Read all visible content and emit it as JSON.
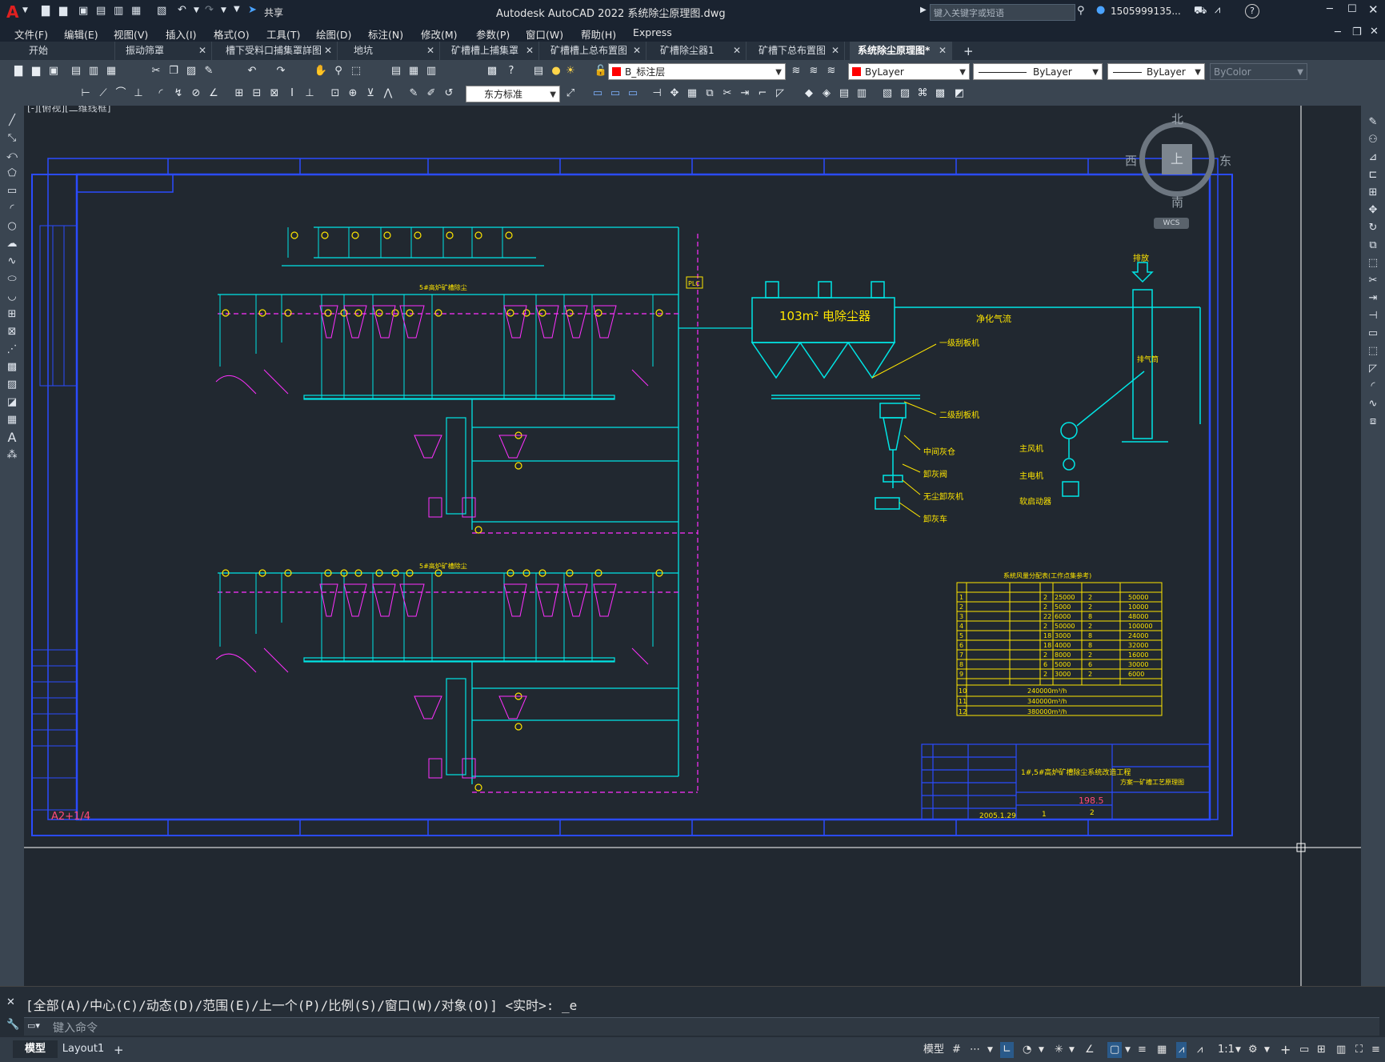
{
  "titlebar": {
    "app_letter": "A",
    "share_label": "共享",
    "title": "Autodesk AutoCAD 2022    系统除尘原理图.dwg",
    "search_placeholder": "键入关键字或短语",
    "user": "1505999135...",
    "help": "?"
  },
  "menu": [
    "文件(F)",
    "编辑(E)",
    "视图(V)",
    "插入(I)",
    "格式(O)",
    "工具(T)",
    "绘图(D)",
    "标注(N)",
    "修改(M)",
    "参数(P)",
    "窗口(W)",
    "帮助(H)",
    "Express"
  ],
  "tabs": [
    {
      "label": "开始",
      "active": false,
      "close": false
    },
    {
      "label": "振动筛罩",
      "active": false,
      "close": true
    },
    {
      "label": "槽下受料口捕集罩詳图",
      "active": false,
      "close": true
    },
    {
      "label": "地坑",
      "active": false,
      "close": true
    },
    {
      "label": "矿槽槽上捕集罩",
      "active": false,
      "close": true
    },
    {
      "label": "矿槽槽上总布置图",
      "active": false,
      "close": true
    },
    {
      "label": "矿槽除尘器1",
      "active": false,
      "close": true
    },
    {
      "label": "矿槽下总布置图",
      "active": false,
      "close": true
    },
    {
      "label": "系统除尘原理图*",
      "active": true,
      "close": true
    }
  ],
  "toolbar": {
    "layer": "B_标注层",
    "color": "ByLayer",
    "linetype": "ByLayer",
    "lineweight": "ByLayer",
    "plotstyle": "ByColor",
    "dimstyle": "东方标准"
  },
  "viewport": {
    "label": "[-][俯视][二维线框]",
    "compass_n": "北",
    "compass_s": "南",
    "compass_e": "东",
    "compass_w": "西",
    "compass_center": "上",
    "wcs": "WCS"
  },
  "drawing": {
    "collector_label": "103m² 电除尘器",
    "clean_gas": "净化气流",
    "exhaust": "排放",
    "stack": "排气筒",
    "labels_right": [
      "一级刮板机",
      "二级刮板机",
      "中间灰仓",
      "卸灰阀",
      "无尘卸灰机",
      "卸灰车",
      "主风机",
      "主电机",
      "软启动器"
    ],
    "upper_group": "5#高炉矿槽除尘",
    "lower_group": "5#高炉矿槽除尘",
    "plc": "PLC",
    "sheet_mark": "A2+1/4",
    "table_title": "系統风量分配表(工作点集参考)",
    "table_rows": [
      [
        "1",
        "",
        "",
        "2",
        "25000",
        "2",
        "50000"
      ],
      [
        "2",
        "",
        "",
        "2",
        "5000",
        "2",
        "10000"
      ],
      [
        "3",
        "",
        "",
        "22",
        "6000",
        "8",
        "48000"
      ],
      [
        "4",
        "",
        "",
        "2",
        "50000",
        "2",
        "100000"
      ],
      [
        "5",
        "",
        "",
        "18",
        "3000",
        "8",
        "24000"
      ],
      [
        "6",
        "",
        "",
        "18",
        "4000",
        "8",
        "32000"
      ],
      [
        "7",
        "",
        "",
        "2",
        "8000",
        "2",
        "16000"
      ],
      [
        "8",
        "",
        "",
        "6",
        "5000",
        "6",
        "30000"
      ],
      [
        "9",
        "",
        "",
        "2",
        "3000",
        "2",
        "6000"
      ]
    ],
    "table_summary": [
      [
        "10",
        "",
        "240000m³/h"
      ],
      [
        "11",
        "",
        "340000m³/h"
      ],
      [
        "12",
        "",
        "380000m³/h"
      ]
    ],
    "titleblock_project": "1#,5#高炉矿槽除尘系统改造工程",
    "titleblock_drawing": "方案一矿槽工艺原理图",
    "titleblock_date": "2005.1.29",
    "titleblock_num": "198.5",
    "titleblock_n1": "1",
    "titleblock_n2": "2"
  },
  "command": {
    "history": "[全部(A)/中心(C)/动态(D)/范围(E)/上一个(P)/比例(S)/窗口(W)/对象(O)] <实时>: _e",
    "placeholder": "键入命令"
  },
  "status": {
    "tab_model": "模型",
    "tab_layout": "Layout1",
    "model": "模型",
    "scale": "1:1"
  }
}
